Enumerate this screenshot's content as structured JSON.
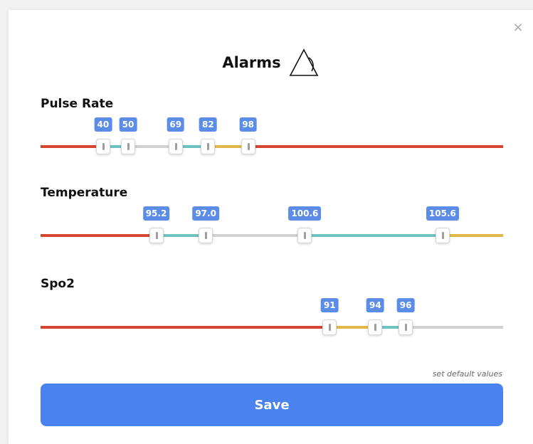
{
  "dialog": {
    "title": "Alarms",
    "close_glyph": "×",
    "title_icon": "alarm-bell-icon"
  },
  "colors": {
    "red": "#d54532",
    "teal": "#6cc3bf",
    "gray": "#d2d2d2",
    "yellow": "#e0b84a",
    "badge": "#5b8de8",
    "button": "#4a82f0"
  },
  "sliders": [
    {
      "label": "Pulse Rate",
      "scale": [
        15,
        200
      ],
      "values": [
        "40",
        "50",
        "69",
        "82",
        "98"
      ],
      "segments": [
        "red",
        "teal",
        "gray",
        "teal",
        "yellow",
        "red"
      ]
    },
    {
      "label": "Temperature",
      "scale": [
        91.0,
        107.8
      ],
      "values": [
        "95.2",
        "97.0",
        "100.6",
        "105.6"
      ],
      "segments": [
        "red",
        "teal",
        "gray",
        "teal",
        "yellow"
      ]
    },
    {
      "label": "Spo2",
      "scale": [
        72,
        102.4
      ],
      "values": [
        "91",
        "94",
        "96"
      ],
      "segments": [
        "red",
        "yellow",
        "teal",
        "gray"
      ]
    }
  ],
  "footer": {
    "default_link": "set default values",
    "save_label": "Save"
  }
}
